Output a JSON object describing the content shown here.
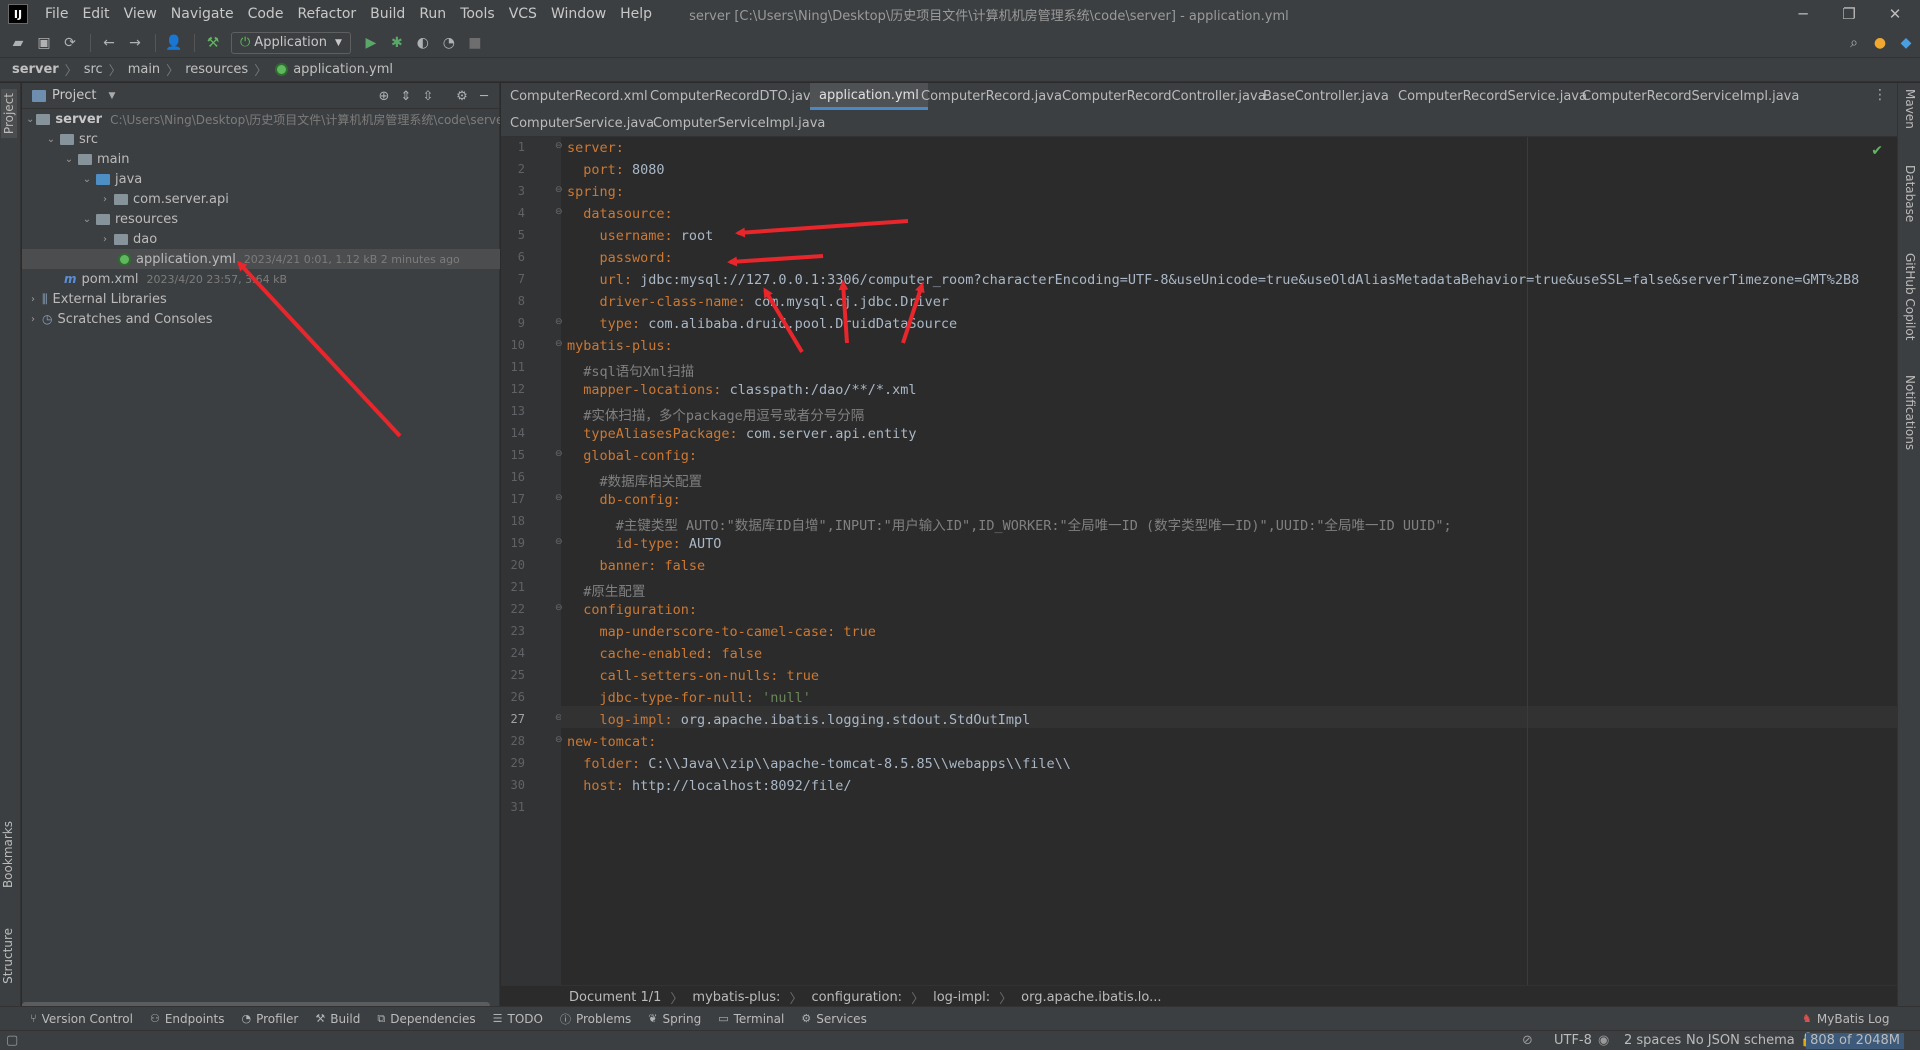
{
  "titlebar": {
    "logo": "IJ",
    "menu": [
      "File",
      "Edit",
      "View",
      "Navigate",
      "Code",
      "Refactor",
      "Build",
      "Run",
      "Tools",
      "VCS",
      "Window",
      "Help"
    ],
    "title": "server [C:\\Users\\Ning\\Desktop\\历史项目文件\\计算机机房管理系统\\code\\server] - application.yml",
    "minimize": "─",
    "maximize": "❐",
    "close": "✕"
  },
  "toolbar": {
    "run_config": "Application"
  },
  "breadcrumb": [
    "server",
    "src",
    "main",
    "resources",
    "application.yml"
  ],
  "left_strip": {
    "project": "Project",
    "bookmarks": "Bookmarks",
    "structure": "Structure"
  },
  "right_strip": {
    "maven": "Maven",
    "database": "Database",
    "copilot": "GitHub Copilot",
    "notifications": "Notifications"
  },
  "project": {
    "title": "Project",
    "tree": [
      {
        "label": "server",
        "meta": "C:\\Users\\Ning\\Desktop\\历史项目文件\\计算机机房管理系统\\code\\server"
      },
      {
        "label": "src",
        "meta": ""
      },
      {
        "label": "main",
        "meta": ""
      },
      {
        "label": "java",
        "meta": ""
      },
      {
        "label": "com.server.api",
        "meta": ""
      },
      {
        "label": "resources",
        "meta": ""
      },
      {
        "label": "dao",
        "meta": ""
      },
      {
        "label": "application.yml",
        "meta": "2023/4/21 0:01, 1.12 kB 2 minutes ago"
      },
      {
        "label": "pom.xml",
        "meta": "2023/4/20 23:57, 3.64 kB"
      },
      {
        "label": "External Libraries",
        "meta": ""
      },
      {
        "label": "Scratches and Consoles",
        "meta": ""
      }
    ]
  },
  "tabs": [
    "ComputerRecord.xml",
    "ComputerRecordDTO.java",
    "application.yml",
    "ComputerRecord.java",
    "ComputerRecordController.java",
    "BaseController.java",
    "ComputerRecordService.java",
    "ComputerRecordServiceImpl.java",
    "ComputerService.java",
    "ComputerServiceImpl.java"
  ],
  "code": [
    {
      "k": "server:",
      "v": "",
      "t": ""
    },
    {
      "k": "  port:",
      "v": " 8080",
      "t": "v"
    },
    {
      "k": "spring:",
      "v": "",
      "t": ""
    },
    {
      "k": "  datasource:",
      "v": "",
      "t": ""
    },
    {
      "k": "    username:",
      "v": " root",
      "t": "v"
    },
    {
      "k": "    password:",
      "v": "",
      "t": ""
    },
    {
      "k": "    url:",
      "v": " jdbc:mysql://127.0.0.1:3306/computer_room?characterEncoding=UTF-8&useUnicode=true&useOldAliasMetadataBehavior=true&useSSL=false&serverTimezone=GMT%2B8",
      "t": "v"
    },
    {
      "k": "    driver-class-name:",
      "v": " com.mysql.cj.jdbc.Driver",
      "t": "v"
    },
    {
      "k": "    type:",
      "v": " com.alibaba.druid.pool.DruidDataSource",
      "t": "v"
    },
    {
      "k": "mybatis-plus:",
      "v": "",
      "t": ""
    },
    {
      "k": "",
      "v": "  #sql语句Xml扫描",
      "t": "c"
    },
    {
      "k": "  mapper-locations:",
      "v": " classpath:/dao/**/*.xml",
      "t": "v"
    },
    {
      "k": "",
      "v": "  #实体扫描，多个package用逗号或者分号分隔",
      "t": "c"
    },
    {
      "k": "  typeAliasesPackage:",
      "v": " com.server.api.entity",
      "t": "v"
    },
    {
      "k": "  global-config:",
      "v": "",
      "t": ""
    },
    {
      "k": "",
      "v": "    #数据库相关配置",
      "t": "c"
    },
    {
      "k": "    db-config:",
      "v": "",
      "t": ""
    },
    {
      "k": "",
      "v": "      #主键类型 AUTO:\"数据库ID自增\",INPUT:\"用户输入ID\",ID_WORKER:\"全局唯一ID (数字类型唯一ID)\",UUID:\"全局唯一ID UUID\";",
      "t": "c"
    },
    {
      "k": "      id-type:",
      "v": " AUTO",
      "t": "v"
    },
    {
      "k": "    banner:",
      "v": " false",
      "t": "k"
    },
    {
      "k": "",
      "v": "  #原生配置",
      "t": "c"
    },
    {
      "k": "  configuration:",
      "v": "",
      "t": ""
    },
    {
      "k": "    map-underscore-to-camel-case:",
      "v": " true",
      "t": "k"
    },
    {
      "k": "    cache-enabled:",
      "v": " false",
      "t": "k"
    },
    {
      "k": "    call-setters-on-nulls:",
      "v": " true",
      "t": "k"
    },
    {
      "k": "    jdbc-type-for-null:",
      "v": " 'null'",
      "t": "s"
    },
    {
      "k": "    log-impl:",
      "v": " org.apache.ibatis.logging.stdout.StdOutImpl",
      "t": "v"
    },
    {
      "k": "new-tomcat:",
      "v": "",
      "t": ""
    },
    {
      "k": "  folder:",
      "v": " C:\\\\Java\\\\zip\\\\apache-tomcat-8.5.85\\\\webapps\\\\file\\\\",
      "t": "v"
    },
    {
      "k": "  host:",
      "v": " http://localhost:8092/file/",
      "t": "v"
    },
    {
      "k": "",
      "v": "",
      "t": ""
    }
  ],
  "editor_breadcrumb": [
    "Document 1/1",
    "mybatis-plus:",
    "configuration:",
    "log-impl:",
    "org.apache.ibatis.lo..."
  ],
  "bottom_tools": [
    "Version Control",
    "Endpoints",
    "Profiler",
    "Build",
    "Dependencies",
    "TODO",
    "Problems",
    "Spring",
    "Terminal",
    "Services"
  ],
  "mybatis_log": "MyBatis Log",
  "status": {
    "encoding": "UTF-8",
    "indent": "2 spaces",
    "schema": "No JSON schema",
    "memory": "808 of 2048M"
  },
  "colors": {
    "keyword": "#cc7832",
    "value": "#a9b7c6",
    "string": "#6a8759",
    "comment": "#808080",
    "annotation_arrow": "#e8262b"
  }
}
